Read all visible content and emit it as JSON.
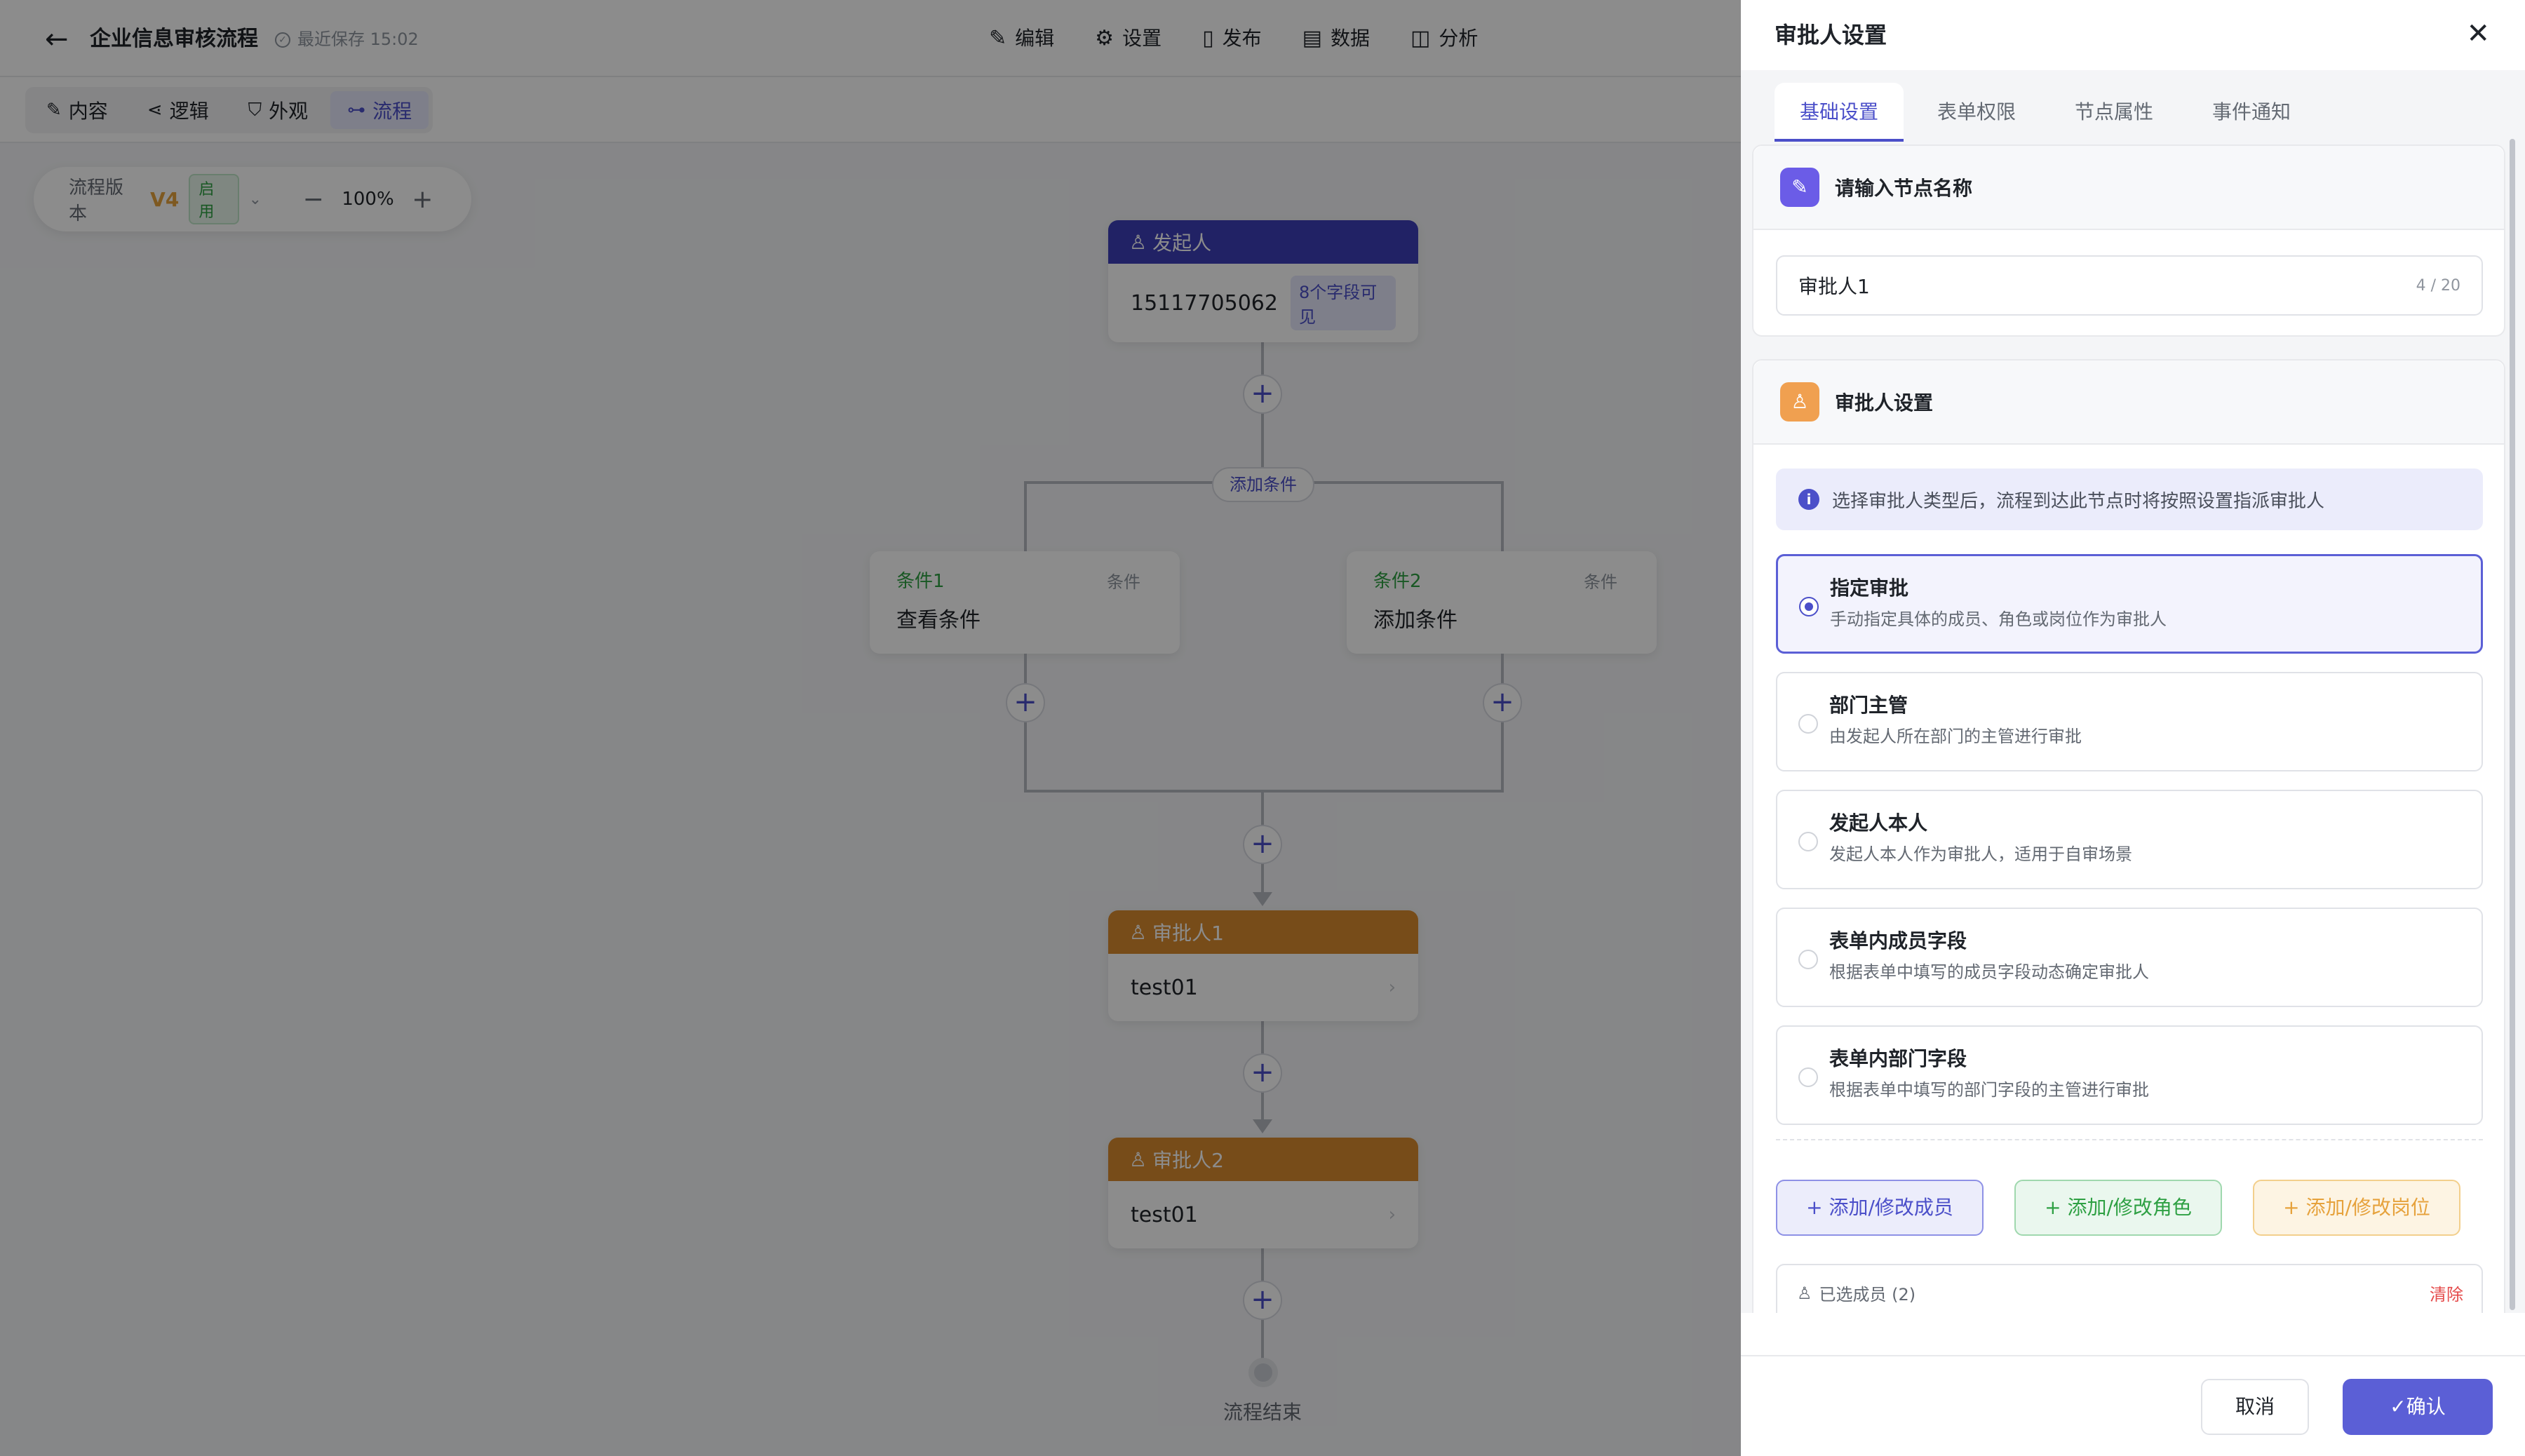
{
  "app": {
    "title": "企业信息审核流程",
    "save_status": "最近保存 15:02",
    "nav": [
      {
        "label": "编辑",
        "icon": "edit-icon"
      },
      {
        "label": "设置",
        "icon": "gear-icon"
      },
      {
        "label": "发布",
        "icon": "publish-icon"
      },
      {
        "label": "数据",
        "icon": "document-icon"
      },
      {
        "label": "分析",
        "icon": "analytics-icon"
      }
    ],
    "modes": [
      {
        "label": "内容",
        "icon": "edit-icon"
      },
      {
        "label": "逻辑",
        "icon": "share-icon"
      },
      {
        "label": "外观",
        "icon": "shirt-icon"
      },
      {
        "label": "流程",
        "icon": "flow-icon"
      }
    ],
    "active_mode": "流程"
  },
  "version": {
    "label": "流程版本",
    "value": "V4",
    "status": "启用",
    "zoom": "100%"
  },
  "flow": {
    "start": {
      "head": "发起人",
      "value": "15117705062",
      "tag": "8个字段可见"
    },
    "add_condition": "添加条件",
    "conditions": [
      {
        "name": "条件1",
        "type": "条件",
        "desc": "查看条件"
      },
      {
        "name": "条件2",
        "type": "条件",
        "desc": "添加条件"
      }
    ],
    "approvers": [
      {
        "head": "审批人1",
        "value": "test01"
      },
      {
        "head": "审批人2",
        "value": "test01"
      }
    ],
    "end_label": "流程结束"
  },
  "drawer": {
    "title": "审批人设置",
    "tabs": [
      "基础设置",
      "表单权限",
      "节点属性",
      "事件通知"
    ],
    "active_tab": "基础设置",
    "name_section": {
      "title": "请输入节点名称",
      "value": "审批人1",
      "count": "4 / 20"
    },
    "approver_section": {
      "title": "审批人设置",
      "info": "选择审批人类型后，流程到达此节点时将按照设置指派审批人",
      "options": [
        {
          "title": "指定审批",
          "desc": "手动指定具体的成员、角色或岗位作为审批人",
          "selected": true
        },
        {
          "title": "部门主管",
          "desc": "由发起人所在部门的主管进行审批",
          "selected": false
        },
        {
          "title": "发起人本人",
          "desc": "发起人本人作为审批人，适用于自审场景",
          "selected": false
        },
        {
          "title": "表单内成员字段",
          "desc": "根据表单中填写的成员字段动态确定审批人",
          "selected": false
        },
        {
          "title": "表单内部门字段",
          "desc": "根据表单中填写的部门字段的主管进行审批",
          "selected": false
        }
      ],
      "buttons": [
        "添加/修改成员",
        "添加/修改角色",
        "添加/修改岗位"
      ],
      "selected_label": "已选成员 (2)",
      "clear": "清除"
    },
    "footer": {
      "cancel": "取消",
      "confirm": "确认"
    }
  },
  "colors": {
    "accent": "#5b5fd6",
    "start_node": "#3d3fb8",
    "approver_node": "#d98a2e",
    "condition_text": "#2ea043",
    "danger": "#e54b4b"
  }
}
